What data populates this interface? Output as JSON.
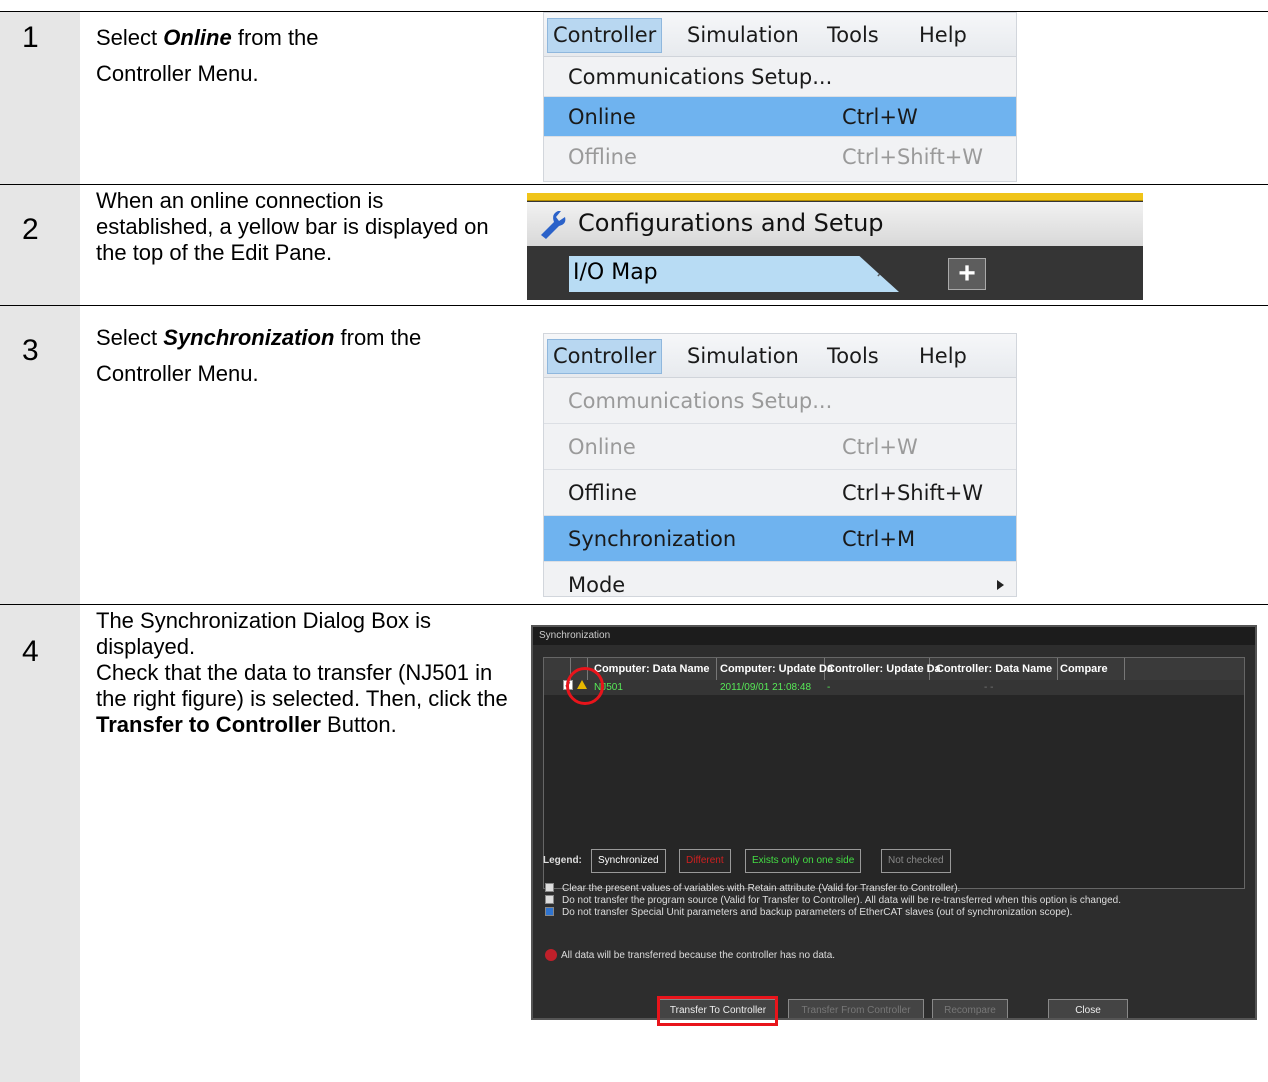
{
  "steps": [
    {
      "number": "1",
      "text_before": "Select ",
      "emphasis": "Online",
      "text_after": " from the Controller Menu."
    },
    {
      "number": "2",
      "text": "When an online connection is established, a yellow bar is displayed on the top of the Edit Pane."
    },
    {
      "number": "3",
      "text_before": "Select ",
      "emphasis": "Synchronization",
      "text_after": " from the Controller Menu."
    },
    {
      "number": "4",
      "line1": "The Synchronization Dialog Box is displayed.",
      "line2": "Check that the data to transfer (NJ501 in the right figure) is selected. Then, click the ",
      "bold": "Transfer to Controller",
      "line2_after": " Button."
    }
  ],
  "menu1": {
    "menubar": [
      "Controller",
      "Simulation",
      "Tools",
      "Help"
    ],
    "items": [
      {
        "label": "Communications Setup...",
        "shortcut": "",
        "state": "normal"
      },
      {
        "label": "Online",
        "shortcut": "Ctrl+W",
        "state": "selected"
      },
      {
        "label": "Offline",
        "shortcut": "Ctrl+Shift+W",
        "state": "disabled"
      }
    ]
  },
  "config": {
    "header": "Configurations and Setup",
    "tab": "I/O Map",
    "tab_close": "×",
    "add_tab": "+"
  },
  "menu2": {
    "menubar": [
      "Controller",
      "Simulation",
      "Tools",
      "Help"
    ],
    "items": [
      {
        "label": "Communications Setup...",
        "shortcut": "",
        "state": "disabled"
      },
      {
        "label": "Online",
        "shortcut": "Ctrl+W",
        "state": "disabled"
      },
      {
        "label": "Offline",
        "shortcut": "Ctrl+Shift+W",
        "state": "normal"
      },
      {
        "label": "Synchronization",
        "shortcut": "Ctrl+M",
        "state": "selected"
      },
      {
        "label": "Mode",
        "shortcut": "",
        "state": "submenu"
      }
    ]
  },
  "sync_dialog": {
    "title": "Synchronization",
    "columns": [
      "Computer: Data Name",
      "Computer: Update Da",
      "Controller: Update Da",
      "Controller: Data Name",
      "Compare"
    ],
    "row": {
      "check": "✓",
      "name": "NJ501",
      "computer_update": "2011/09/01 21:08:48",
      "controller_update": "-",
      "controller_name": "- -"
    },
    "legend_label": "Legend:",
    "legend": [
      "Synchronized",
      "Different",
      "Exists only on one side",
      "Not checked"
    ],
    "options": [
      {
        "checked": false,
        "text": "Clear the present values of variables with Retain attribute (Valid for Transfer to Controller)."
      },
      {
        "checked": false,
        "text": "Do not transfer the program source (Valid for Transfer to Controller). All data will be re-transferred when this option is changed."
      },
      {
        "checked": true,
        "text": "Do not transfer Special Unit parameters and backup parameters of EtherCAT slaves (out of synchronization scope)."
      }
    ],
    "info": "All data will be transferred because the controller has no data.",
    "buttons": [
      "Transfer To Controller",
      "Transfer From Controller",
      "Recompare",
      "Close"
    ]
  }
}
